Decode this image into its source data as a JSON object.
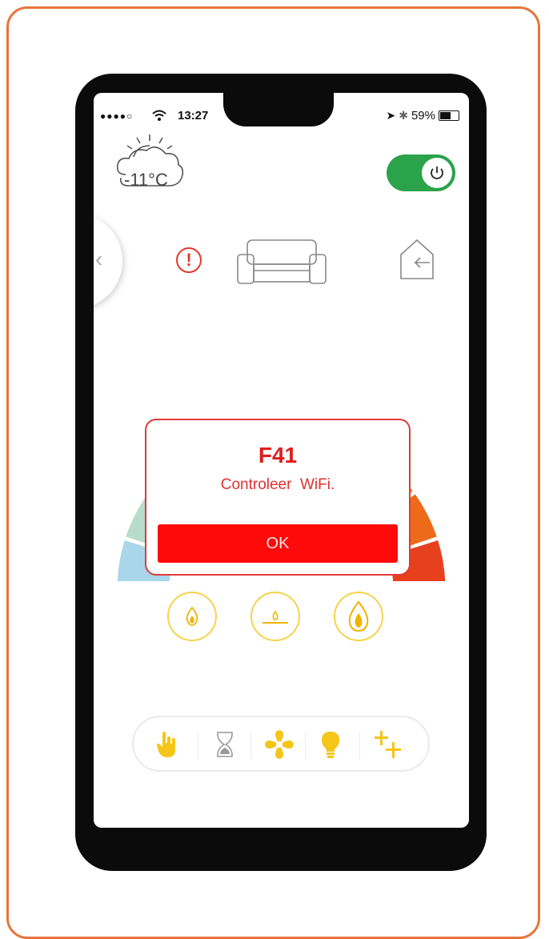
{
  "status_bar": {
    "signal": "●●●●○",
    "time": "13:27",
    "battery": "59%"
  },
  "weather": {
    "temperature": "-11°C",
    "icon": "sun-cloud-icon"
  },
  "power_toggle": {
    "state": "on",
    "icon": "power-icon",
    "color": "#2aa34a"
  },
  "top_icons": [
    "alert-icon",
    "sofa-icon",
    "home-return-icon"
  ],
  "dialog": {
    "code": "F41",
    "message": "Controleer  WiFi.",
    "ok_label": "OK",
    "accent": "#ff0a0a"
  },
  "flame_buttons": [
    "flame-low-icon",
    "flame-pilot-icon",
    "flame-high-icon"
  ],
  "toolbar": [
    "hand-icon",
    "hourglass-icon",
    "fan-icon",
    "bulb-icon",
    "plus-plus-icon"
  ],
  "gauge_colors": [
    "#a9d6ea",
    "#b8dccc",
    "#c7dc9a",
    "#d4df78",
    "#e9e13b",
    "#f6d91a",
    "#f6b51a",
    "#f18c1b",
    "#ec6a1a",
    "#e6401e"
  ]
}
